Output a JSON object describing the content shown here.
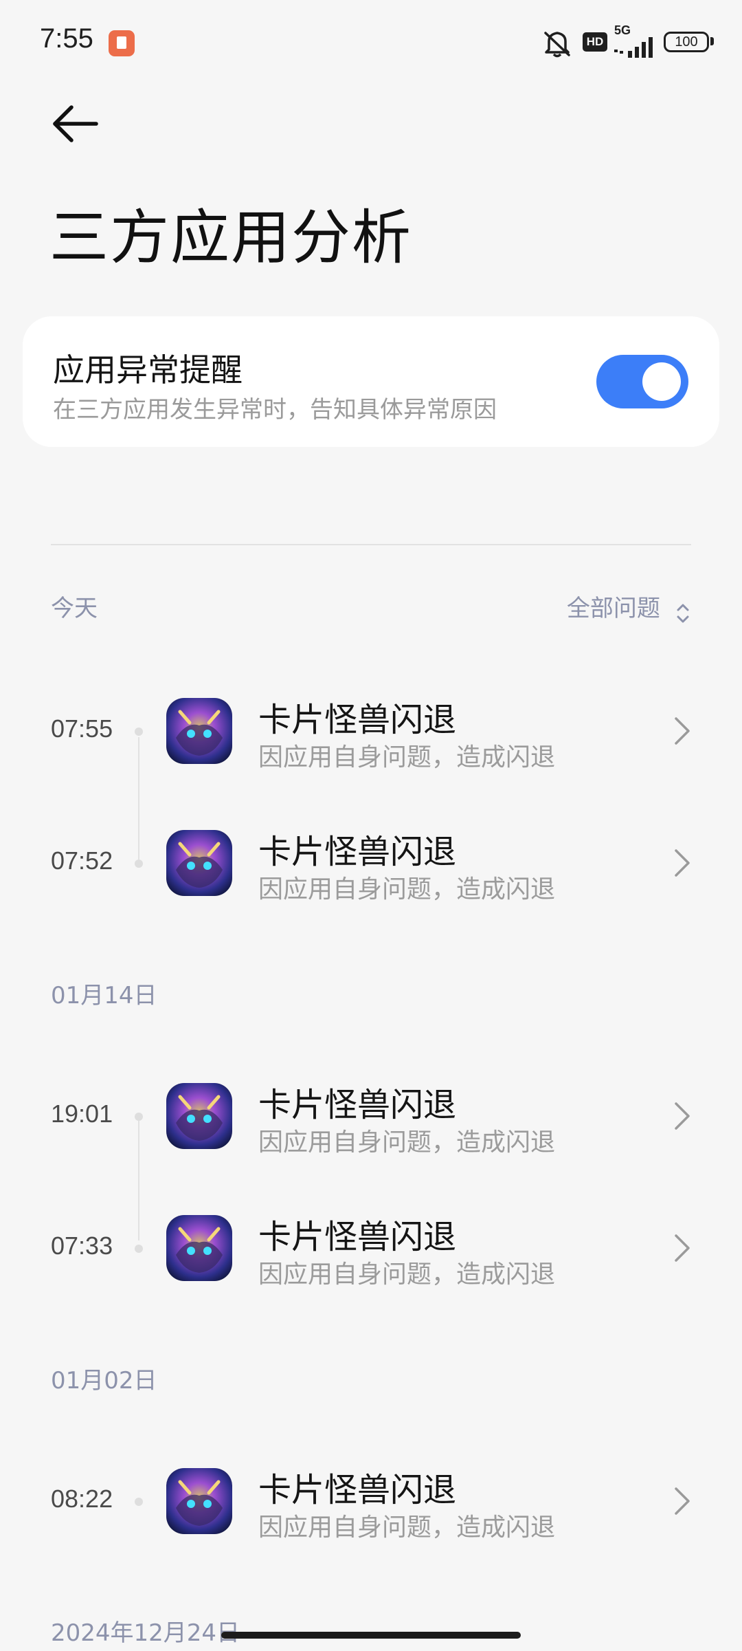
{
  "status_bar": {
    "time": "7:55",
    "network": "5G",
    "hd": "HD",
    "battery": "100",
    "icons": [
      "notification-app-icon",
      "mute-icon",
      "hd-icon",
      "signal-icon",
      "battery-icon"
    ]
  },
  "header": {
    "back_icon": "arrow-left-icon",
    "title": "三方应用分析"
  },
  "alert_card": {
    "title": "应用异常提醒",
    "subtitle": "在三方应用发生异常时，告知具体异常原因",
    "toggle_on": true,
    "accent_color": "#3c7ef8"
  },
  "filter": {
    "label": "全部问题",
    "icon": "sort-updown-icon"
  },
  "sections": [
    {
      "label": "今天",
      "rows": [
        {
          "time": "07:55",
          "title": "卡片怪兽闪退",
          "subtitle": "因应用自身问题，造成闪退"
        },
        {
          "time": "07:52",
          "title": "卡片怪兽闪退",
          "subtitle": "因应用自身问题，造成闪退"
        }
      ]
    },
    {
      "label": "01月14日",
      "rows": [
        {
          "time": "19:01",
          "title": "卡片怪兽闪退",
          "subtitle": "因应用自身问题，造成闪退"
        },
        {
          "time": "07:33",
          "title": "卡片怪兽闪退",
          "subtitle": "因应用自身问题，造成闪退"
        }
      ]
    },
    {
      "label": "01月02日",
      "rows": [
        {
          "time": "08:22",
          "title": "卡片怪兽闪退",
          "subtitle": "因应用自身问题，造成闪退"
        }
      ]
    },
    {
      "label": "2024年12月24日",
      "rows": []
    }
  ]
}
